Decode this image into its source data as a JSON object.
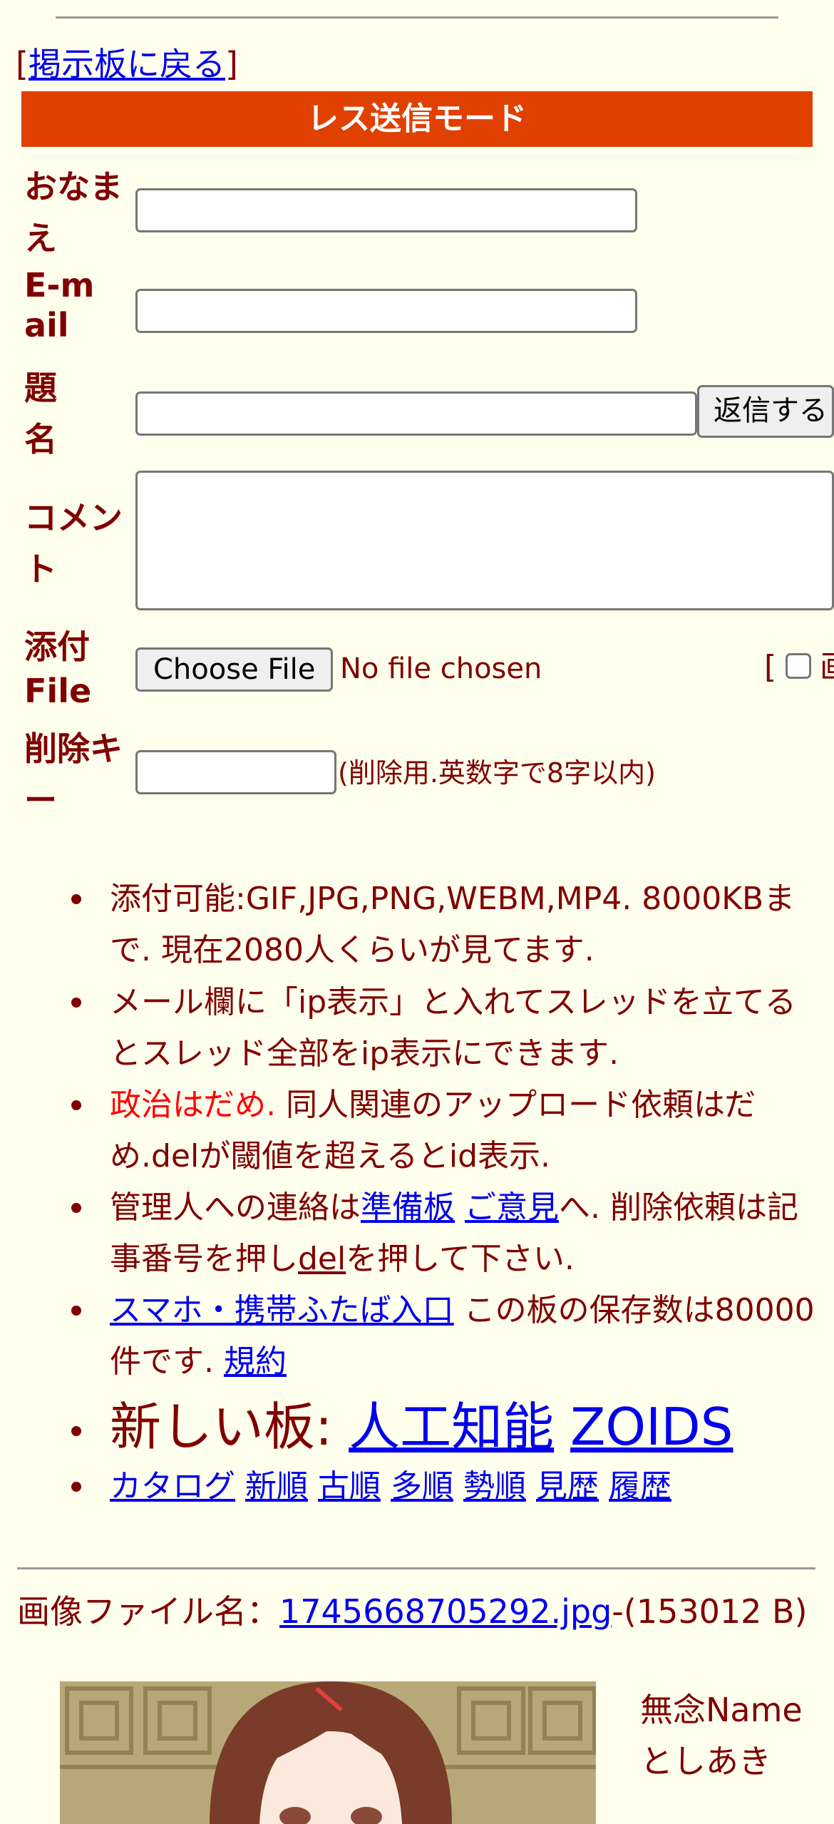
{
  "nav": {
    "bracket_open": "[",
    "back_link": "掲示板に戻る",
    "bracket_close": "]"
  },
  "form": {
    "title": "レス送信モード",
    "name_label": "おなまえ",
    "email_label": "E-mail",
    "subject_label": "題名",
    "submit_label": "返信する",
    "comment_label": "コメント",
    "file_label": "添付File",
    "file_button": "Choose File",
    "file_status": "No file chosen",
    "file_option_prefix": "[",
    "file_option_text": "画",
    "delkey_label": "削除キー",
    "delkey_note": "(削除用.英数字で8字以内)",
    "name_value": "",
    "email_value": "",
    "subject_value": "",
    "comment_value": "",
    "delkey_value": ""
  },
  "info": {
    "item1": "添付可能:GIF,JPG,PNG,WEBM,MP4. 8000KBまで. 現在2080人くらいが見てます.",
    "item2": "メール欄に「ip表示」と入れてスレッドを立てるとスレッド全部をip表示にできます.",
    "item3_red": "政治はだめ.",
    "item3_rest": " 同人関連のアップロード依頼はだめ.delが閾値を超えるとid表示.",
    "item4_a": "管理人への連絡は",
    "item4_link1": "準備板",
    "item4_link2": "ご意見",
    "item4_b": "へ. 削除依頼は記事番号を押し",
    "item4_link3": "del",
    "item4_c": "を押して下さい.",
    "item5_link1": "スマホ・携帯ふたば入口",
    "item5_b": " この板の保存数は80000件です. ",
    "item5_link2": "規約",
    "item6_label": "新しい板: ",
    "item6_link1": "人工知能",
    "item6_link2": "ZOIDS",
    "item7_links": [
      "カタログ",
      "新順",
      "古順",
      "多順",
      "勢順",
      "見歴",
      "履歴"
    ]
  },
  "post": {
    "file_prefix": "画像ファイル名：",
    "file_link": "1745668705292.jpg",
    "file_size": "-(153012 B)",
    "name_line1": "無念Name",
    "name_line2": "としあき"
  }
}
